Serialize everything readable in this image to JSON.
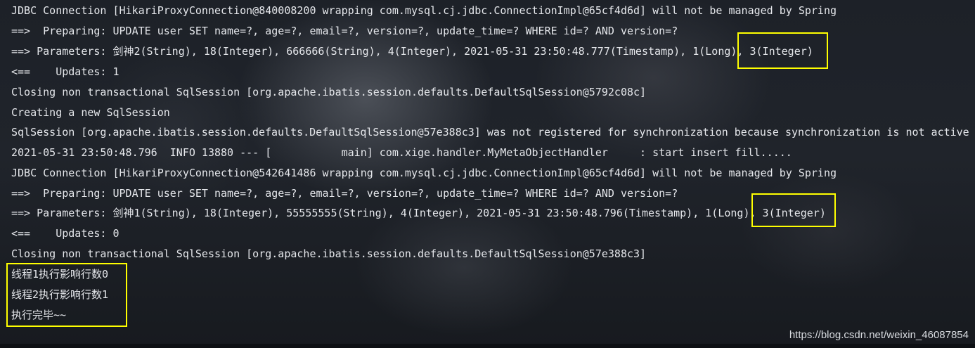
{
  "console": {
    "lines": [
      "JDBC Connection [HikariProxyConnection@840008200 wrapping com.mysql.cj.jdbc.ConnectionImpl@65cf4d6d] will not be managed by Spring",
      "==>  Preparing: UPDATE user SET name=?, age=?, email=?, version=?, update_time=? WHERE id=? AND version=?",
      "==> Parameters: 剑神2(String), 18(Integer), 666666(String), 4(Integer), 2021-05-31 23:50:48.777(Timestamp), 1(Long), 3(Integer)",
      "<==    Updates: 1",
      "Closing non transactional SqlSession [org.apache.ibatis.session.defaults.DefaultSqlSession@5792c08c]",
      "Creating a new SqlSession",
      "SqlSession [org.apache.ibatis.session.defaults.DefaultSqlSession@57e388c3] was not registered for synchronization because synchronization is not active",
      "2021-05-31 23:50:48.796  INFO 13880 --- [           main] com.xige.handler.MyMetaObjectHandler     : start insert fill.....",
      "JDBC Connection [HikariProxyConnection@542641486 wrapping com.mysql.cj.jdbc.ConnectionImpl@65cf4d6d] will not be managed by Spring",
      "==>  Preparing: UPDATE user SET name=?, age=?, email=?, version=?, update_time=? WHERE id=? AND version=?",
      "==> Parameters: 剑神1(String), 18(Integer), 55555555(String), 4(Integer), 2021-05-31 23:50:48.796(Timestamp), 1(Long), 3(Integer)",
      "<==    Updates: 0",
      "Closing non transactional SqlSession [org.apache.ibatis.session.defaults.DefaultSqlSession@57e388c3]",
      "线程1执行影响行数0",
      "线程2执行影响行数1",
      "执行完毕~~"
    ]
  },
  "highlight_color": "#ffff00",
  "watermark": "https://blog.csdn.net/weixin_46087854"
}
